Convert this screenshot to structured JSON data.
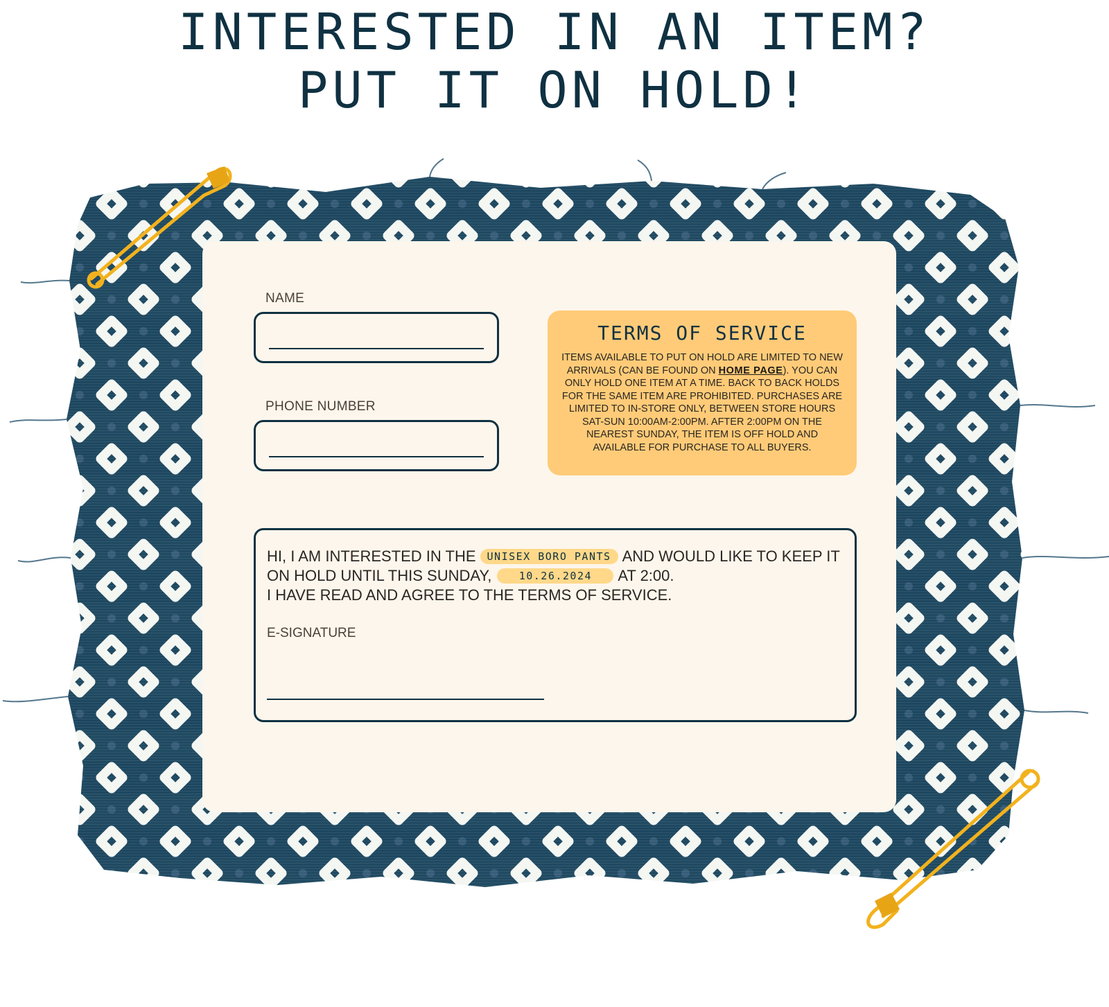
{
  "headline": {
    "line1": "INTERESTED IN AN ITEM?",
    "line2": "PUT IT ON HOLD!"
  },
  "form": {
    "name_label": "NAME",
    "name_value": "",
    "phone_label": "PHONE NUMBER",
    "phone_value": ""
  },
  "terms": {
    "title": "TERMS OF SERVICE",
    "body_part1": "ITEMS AVAILABLE TO PUT ON HOLD ARE LIMITED TO NEW ARRIVALS (CAN BE FOUND ON ",
    "link_label": "HOME PAGE",
    "body_part2": "). YOU CAN ONLY HOLD ONE ITEM AT A TIME. BACK TO BACK HOLDS FOR THE SAME ITEM ARE PROHIBITED. PURCHASES ARE LIMITED TO IN-STORE ONLY, BETWEEN STORE HOURS SAT-SUN 10:00AM-2:00PM. AFTER 2:00PM ON THE NEAREST SUNDAY, THE ITEM IS OFF HOLD AND AVAILABLE FOR PURCHASE TO ALL BUYERS."
  },
  "agreement": {
    "text1": "HI, I AM INTERESTED IN THE",
    "item": "UNISEX BORO PANTS",
    "text2": "AND WOULD LIKE TO KEEP IT ON HOLD UNTIL THIS SUNDAY,",
    "date": "10.26.2024",
    "text3": "AT 2:00.",
    "text4": "I HAVE READ AND AGREE TO THE TERMS OF SERVICE.",
    "signature_label": "E-SIGNATURE"
  },
  "colors": {
    "navy": "#0f3142",
    "cream": "#fdf6ec",
    "tos_background": "#ffcb78",
    "pill_background": "#ffd889",
    "pin_gold": "#f2b21e"
  },
  "icons": {
    "top_left": "safety-pin-icon",
    "bottom_right": "safety-pin-icon"
  }
}
